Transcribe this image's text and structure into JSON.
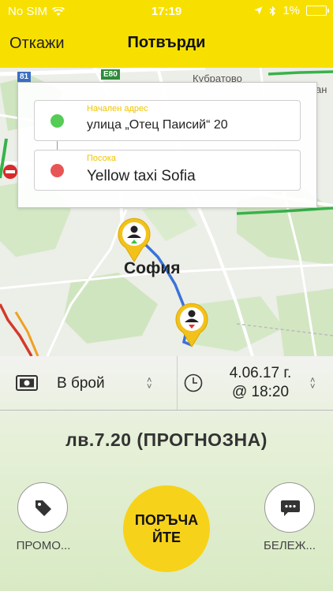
{
  "status_bar": {
    "carrier": "No SIM",
    "time": "17:19",
    "battery": "1%"
  },
  "nav": {
    "cancel_label": "Откажи",
    "title": "Потвърди"
  },
  "map": {
    "city_label": "София",
    "place_label": "Кубратово",
    "road_e80": "E80",
    "road_81": "81",
    "partial_label": "ан"
  },
  "address": {
    "start_label": "Начален адрес",
    "start_value": "улица „Отец Паисий“ 20",
    "dest_label": "Посока",
    "dest_value": "Yellow taxi Sofia"
  },
  "options": {
    "payment": "В брой",
    "date": "4.06.17 г.",
    "time": "@ 18:20"
  },
  "price": "лв.7.20 (ПРОГНОЗНА)",
  "actions": {
    "promo_label": "ПРОМО...",
    "order_label": "ПОРЪЧАЙТЕ",
    "notes_label": "БЕЛЕЖ..."
  },
  "colors": {
    "accent": "#f7e000",
    "start_dot": "#55cc55",
    "dest_dot": "#e85555",
    "order": "#f7d21a"
  }
}
